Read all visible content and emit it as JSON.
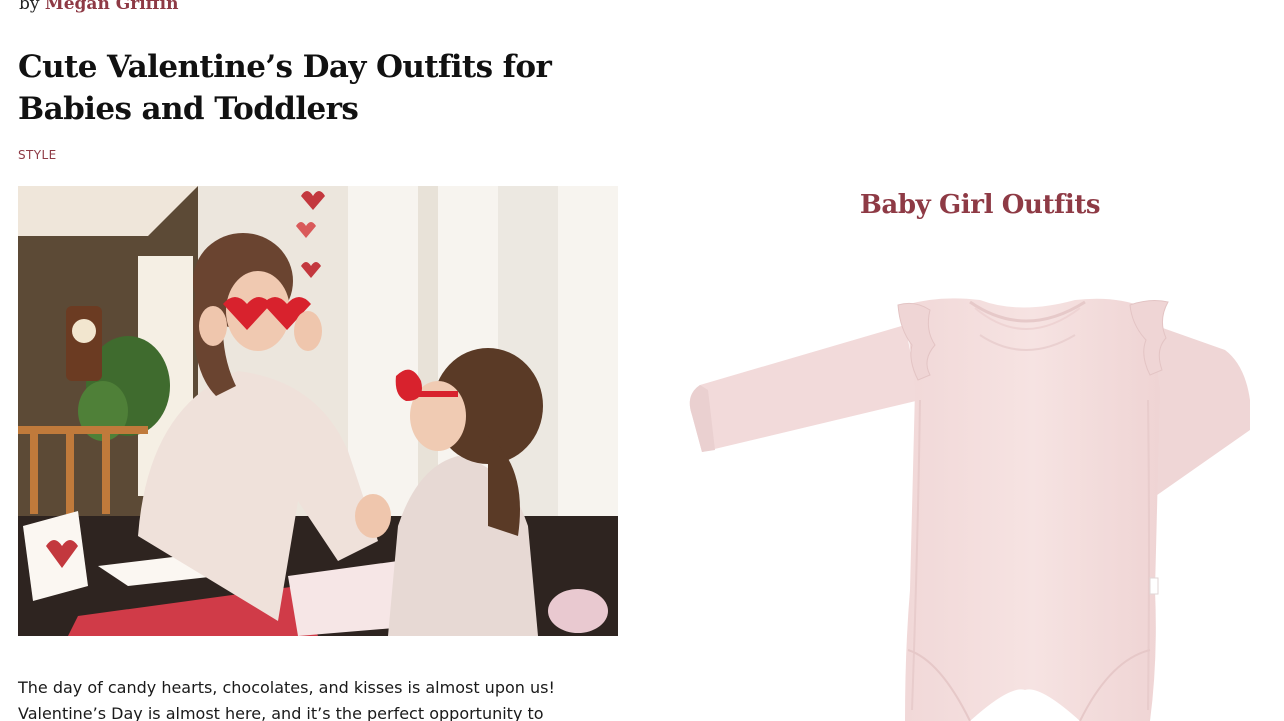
{
  "byline": {
    "prefix": "by",
    "author": "Megan Griffin"
  },
  "article": {
    "title": "Cute Valentine’s Day Outfits for Babies and Toddlers",
    "category": "STYLE",
    "hero_image_alt": "Mother and daughter wearing heart-shaped sunglasses making Valentine cards",
    "body_lines": [
      "The day of candy hearts, chocolates, and kisses is almost upon us!",
      "Valentine’s Day is almost here, and it’s the perfect opportunity to"
    ]
  },
  "section": {
    "heading": "Baby Girl Outfits"
  },
  "product": {
    "image_alt": "Pale pink long-sleeve baby bodysuit with ruffled shoulders"
  },
  "colors": {
    "accent": "#8e3a45",
    "text": "#111111",
    "bodysuit": "#f3dede"
  }
}
